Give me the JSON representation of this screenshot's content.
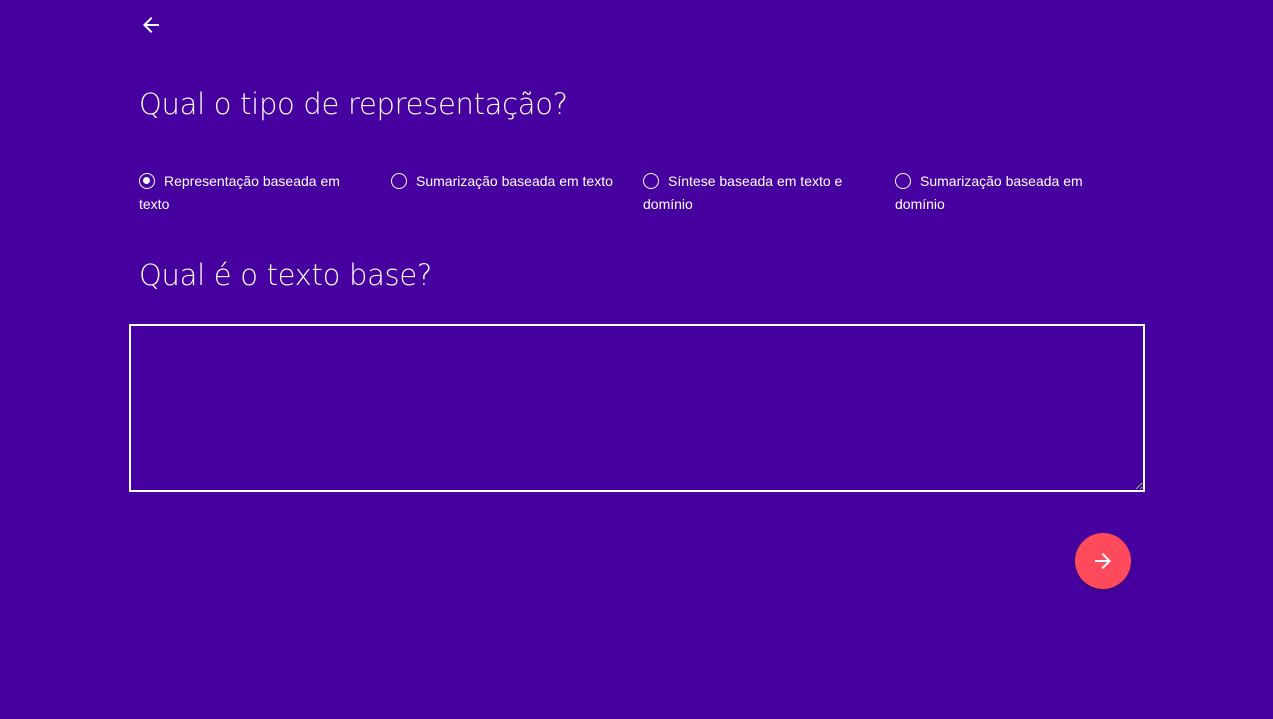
{
  "navigation": {
    "back_icon": "arrow-left-icon"
  },
  "question_type": {
    "title": "Qual o tipo de representação?",
    "options": [
      {
        "label": "Representação baseada em texto",
        "checked": true
      },
      {
        "label": "Sumarização baseada em texto",
        "checked": false
      },
      {
        "label": "Síntese baseada em texto e domínio",
        "checked": false
      },
      {
        "label": "Sumarização baseada em domínio",
        "checked": false
      }
    ]
  },
  "question_text": {
    "title": "Qual é o texto base?",
    "value": "",
    "placeholder": ""
  },
  "next_button": {
    "icon": "arrow-right-icon"
  },
  "colors": {
    "background": "#4700a0",
    "accent": "#ff4a5c",
    "foreground": "#ffffff"
  }
}
